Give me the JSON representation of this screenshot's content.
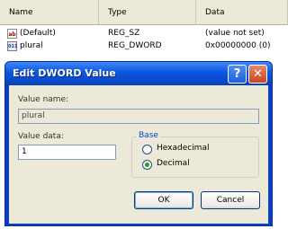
{
  "list": {
    "columns": [
      "Name",
      "Type",
      "Data"
    ],
    "rows": [
      {
        "icon": "ab",
        "name": "(Default)",
        "type": "REG_SZ",
        "data": "(value not set)"
      },
      {
        "icon": "011",
        "name": "plural",
        "type": "REG_DWORD",
        "data": "0x00000000 (0)"
      }
    ]
  },
  "dialog": {
    "title": "Edit DWORD Value",
    "help_glyph": "?",
    "close_glyph": "✕",
    "value_name_label": "Value name:",
    "value_name": "plural",
    "value_data_label": "Value data:",
    "value_data": "1",
    "base_label": "Base",
    "hex_label": "Hexadecimal",
    "dec_label": "Decimal",
    "selected_base": "Decimal",
    "ok_label": "OK",
    "cancel_label": "Cancel"
  },
  "colors": {
    "title_blue": "#0b56e0",
    "face": "#ece9d8",
    "radio_dot": "#21a121"
  }
}
